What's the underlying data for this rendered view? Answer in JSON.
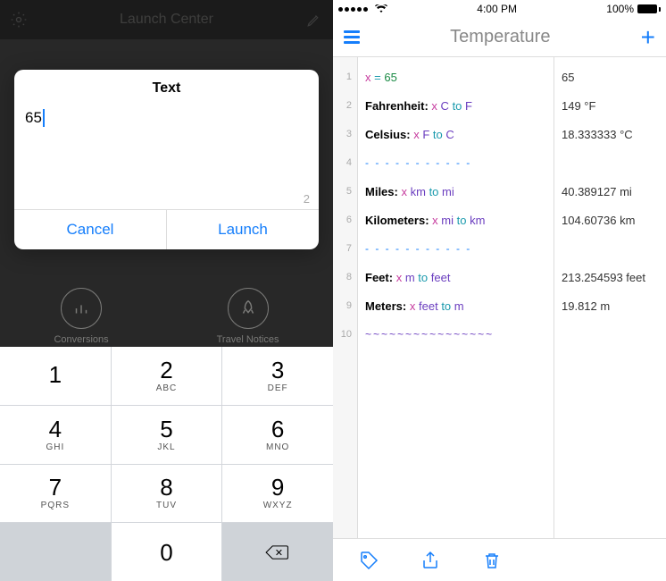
{
  "left": {
    "header": {
      "title": "Launch Center"
    },
    "modal": {
      "title": "Text",
      "input_value": "65",
      "counter": "2",
      "cancel": "Cancel",
      "launch": "Launch"
    },
    "bg_items": [
      {
        "label": "Conversions"
      },
      {
        "label": "Travel Notices"
      }
    ],
    "keypad": [
      {
        "num": "1",
        "sub": ""
      },
      {
        "num": "2",
        "sub": "ABC"
      },
      {
        "num": "3",
        "sub": "DEF"
      },
      {
        "num": "4",
        "sub": "GHI"
      },
      {
        "num": "5",
        "sub": "JKL"
      },
      {
        "num": "6",
        "sub": "MNO"
      },
      {
        "num": "7",
        "sub": "PQRS"
      },
      {
        "num": "8",
        "sub": "TUV"
      },
      {
        "num": "9",
        "sub": "WXYZ"
      },
      {
        "num": "",
        "sub": ""
      },
      {
        "num": "0",
        "sub": ""
      },
      {
        "num": "⌫",
        "sub": ""
      }
    ]
  },
  "right": {
    "status": {
      "time": "4:00 PM",
      "battery": "100%"
    },
    "header": {
      "title": "Temperature"
    },
    "lines": [
      "1",
      "2",
      "3",
      "4",
      "5",
      "6",
      "7",
      "8",
      "9",
      "10"
    ],
    "rows": [
      {
        "type": "assign",
        "var": "x",
        "op": "=",
        "val": "65"
      },
      {
        "type": "conv",
        "label": "Fahrenheit:",
        "var": "x",
        "from": "C",
        "to": "F"
      },
      {
        "type": "conv",
        "label": "Celsius:",
        "var": "x",
        "from": "F",
        "to": "C"
      },
      {
        "type": "dash"
      },
      {
        "type": "conv",
        "label": "Miles:",
        "var": "x",
        "from": "km",
        "to": "mi"
      },
      {
        "type": "conv",
        "label": "Kilometers:",
        "var": "x",
        "from": "mi",
        "to": "km"
      },
      {
        "type": "dash"
      },
      {
        "type": "conv",
        "label": "Feet:",
        "var": "x",
        "from": "m",
        "to": "feet"
      },
      {
        "type": "conv",
        "label": "Meters:",
        "var": "x",
        "from": "feet",
        "to": "m"
      },
      {
        "type": "tilde"
      }
    ],
    "results": [
      "65",
      "149 °F",
      "18.333333 °C",
      "",
      "40.389127 mi",
      "104.60736 km",
      "",
      "213.254593 feet",
      "19.812 m",
      ""
    ]
  }
}
